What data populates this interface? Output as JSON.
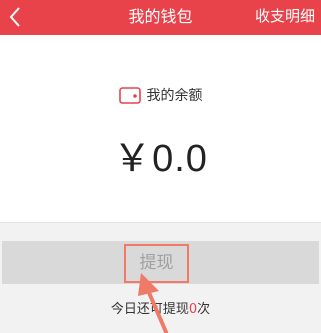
{
  "header": {
    "title": "我的钱包",
    "detail_label": "收支明细",
    "color": "#e8424b"
  },
  "balance": {
    "icon": "wallet-icon",
    "label": "我的余额",
    "amount": "￥0.0"
  },
  "withdraw": {
    "label": "提现"
  },
  "tip": {
    "prefix": "今日还可提现",
    "count": "0",
    "suffix": "次"
  },
  "annotation": {
    "icon": "arrow-icon",
    "color": "#f07a68"
  }
}
